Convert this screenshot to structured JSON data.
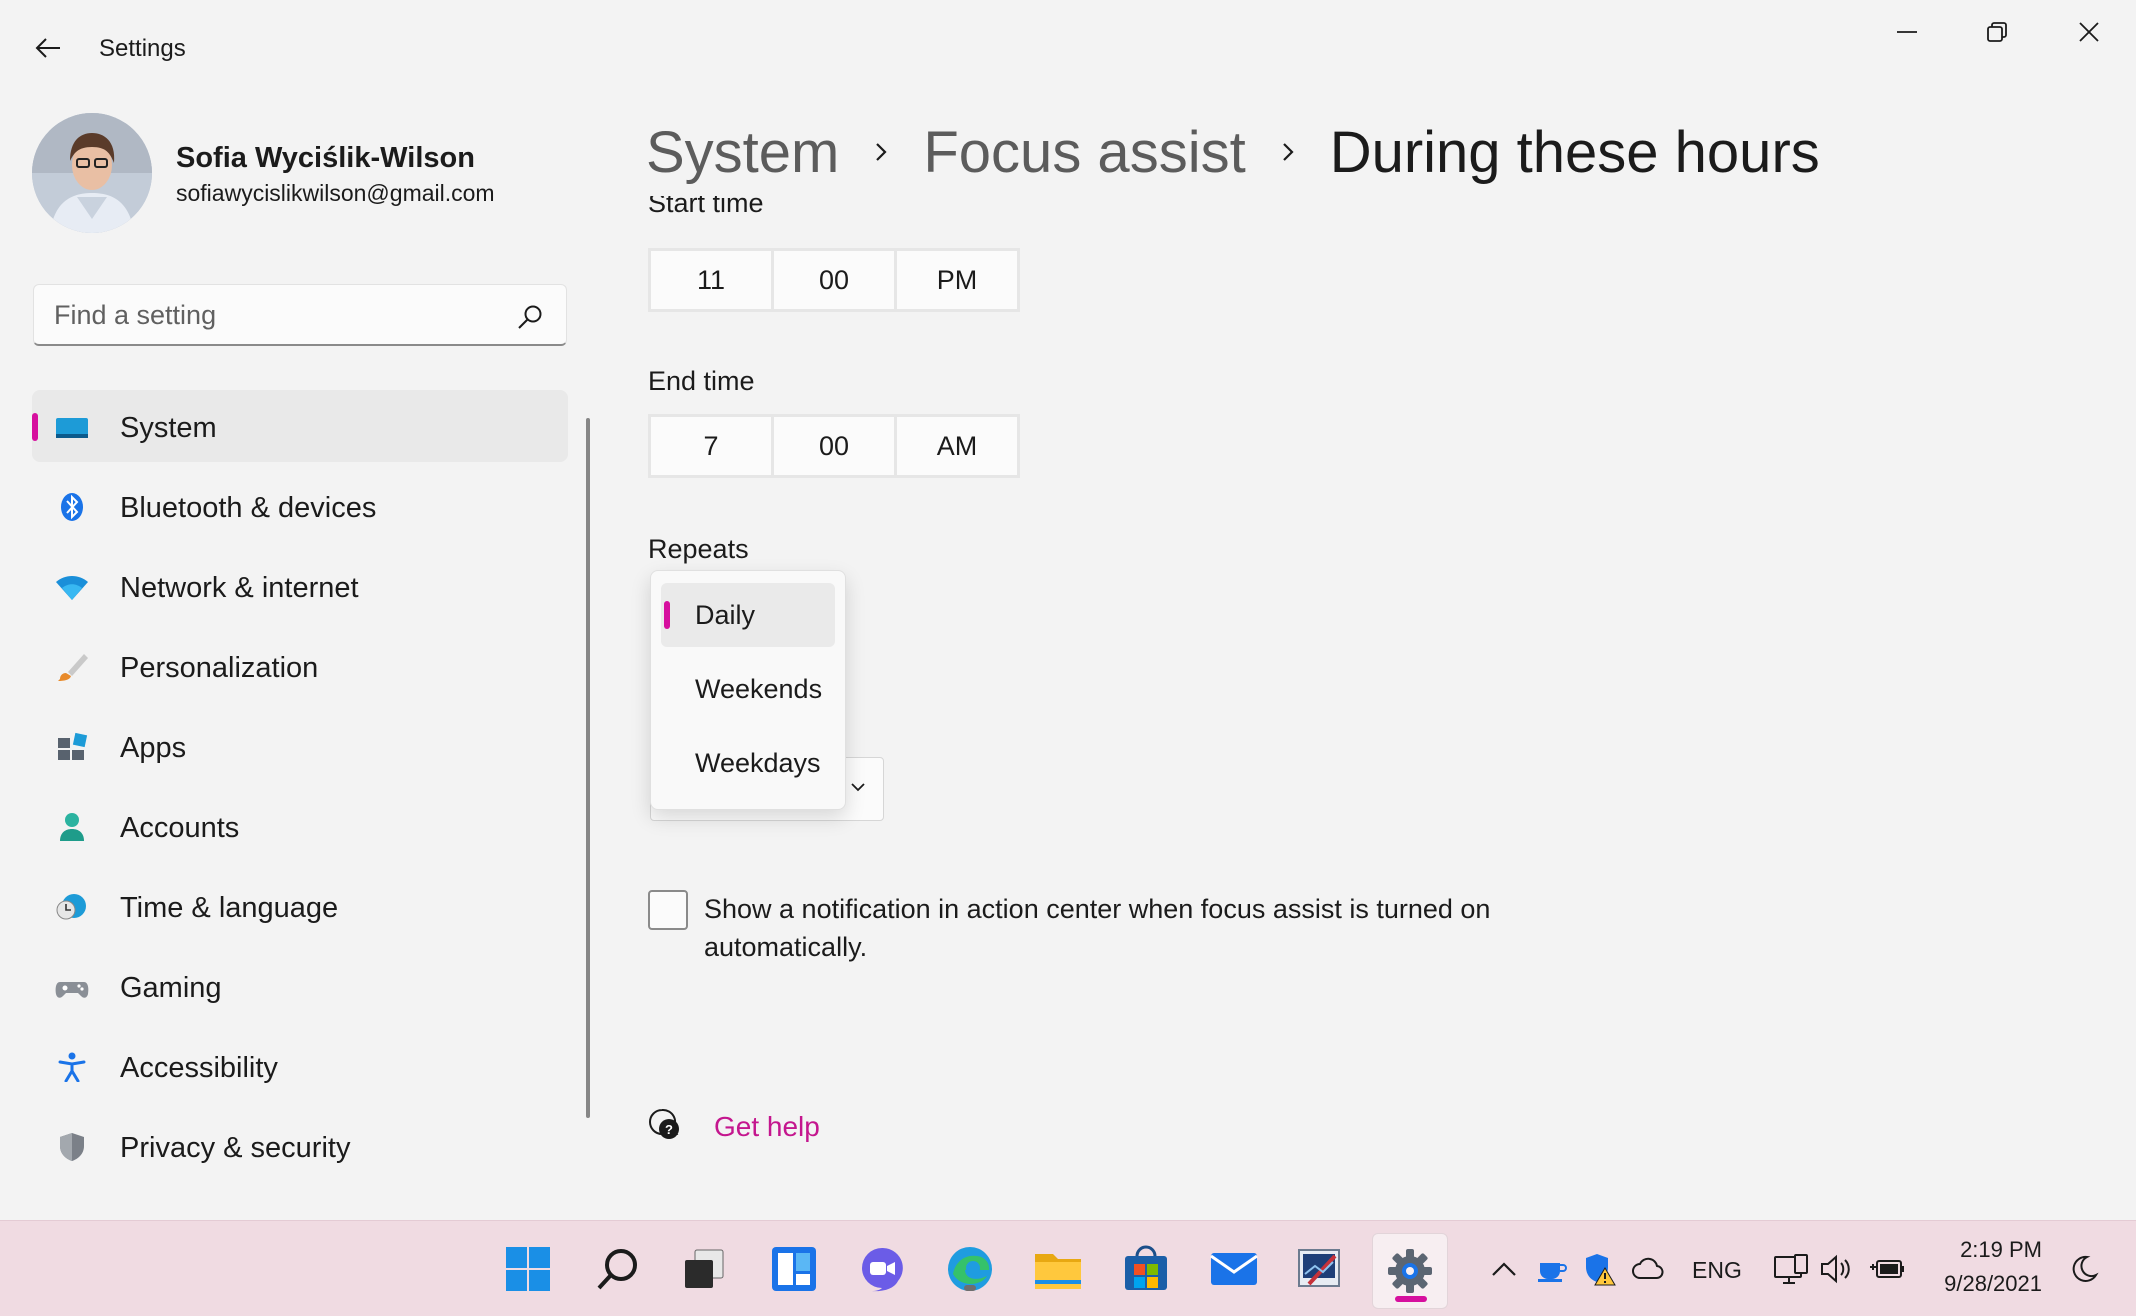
{
  "window": {
    "app_title": "Settings"
  },
  "profile": {
    "name": "Sofia Wyciślik-Wilson",
    "email": "sofiawycislikwilson@gmail.com"
  },
  "search": {
    "placeholder": "Find a setting",
    "value": ""
  },
  "nav": {
    "items": [
      {
        "label": "System",
        "icon": "monitor-icon",
        "selected": true
      },
      {
        "label": "Bluetooth & devices",
        "icon": "bluetooth-icon"
      },
      {
        "label": "Network & internet",
        "icon": "wifi-icon"
      },
      {
        "label": "Personalization",
        "icon": "brush-icon"
      },
      {
        "label": "Apps",
        "icon": "apps-icon"
      },
      {
        "label": "Accounts",
        "icon": "person-icon"
      },
      {
        "label": "Time & language",
        "icon": "globe-clock-icon"
      },
      {
        "label": "Gaming",
        "icon": "gamepad-icon"
      },
      {
        "label": "Accessibility",
        "icon": "accessibility-icon"
      },
      {
        "label": "Privacy & security",
        "icon": "shield-icon"
      }
    ]
  },
  "breadcrumb": {
    "items": [
      "System",
      "Focus assist",
      "During these hours"
    ]
  },
  "schedule": {
    "start_label": "Start time",
    "start": {
      "hour": "11",
      "minute": "00",
      "period": "PM"
    },
    "end_label": "End time",
    "end": {
      "hour": "7",
      "minute": "00",
      "period": "AM"
    },
    "repeats_label": "Repeats",
    "repeats_options": [
      "Daily",
      "Weekends",
      "Weekdays"
    ],
    "repeats_selected": "Daily"
  },
  "notification": {
    "label": "Show a notification in action center when focus assist is turned on automatically.",
    "checked": false
  },
  "help": {
    "label": "Get help"
  },
  "taskbar": {
    "apps": [
      "start-icon",
      "search-icon",
      "task-view-icon",
      "widgets-icon",
      "chat-icon",
      "edge-icon",
      "file-explorer-icon",
      "store-icon",
      "mail-icon",
      "paint-icon",
      "settings-icon"
    ],
    "active_app": "settings-icon",
    "language": "ENG",
    "time": "2:19 PM",
    "date": "9/28/2021"
  },
  "colors": {
    "accent": "#d60f9e",
    "link": "#c4168e",
    "background": "#f3f3f3",
    "taskbar": "#f0dbe2"
  }
}
